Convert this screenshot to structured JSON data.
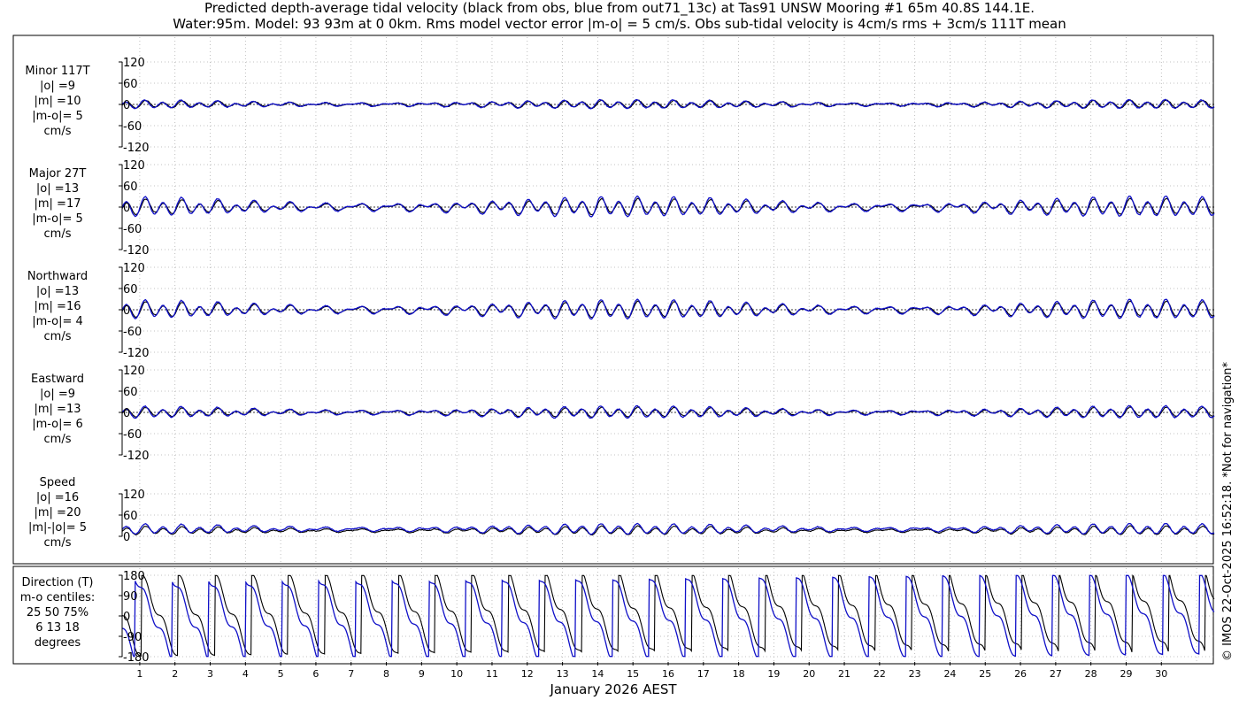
{
  "title_line1": "Predicted depth-average tidal velocity (black from obs, blue from out71_13c) at Tas91 UNSW Mooring #1 65m 40.8S 144.1E.",
  "title_line2": "Water:95m. Model: 93 93m at 0 0km. Rms model vector error |m-o| = 5 cm/s. Obs sub-tidal velocity is 4cm/s rms + 3cm/s 111T mean",
  "side_note": "© IMOS 22-Oct-2025 16:52:18. *Not for navigation*",
  "xlabel": "January 2026 AEST",
  "colors": {
    "obs": "#000000",
    "model": "#1010c8",
    "grid": "#b0b0b0"
  },
  "chart_data": [
    {
      "type": "line",
      "panel": "minor",
      "label_lines": [
        "Minor 117T",
        "|o| =9",
        "|m| =10",
        "|m-o|= 5",
        "cm/s"
      ],
      "yticks": [
        "120",
        "60",
        "0",
        "-60",
        "-120"
      ],
      "ylim": [
        -120,
        120
      ],
      "x_range_days": [
        0.5,
        31.5
      ],
      "grid": true,
      "series": [
        {
          "role": "obs",
          "amp": 9,
          "phase": 0.0,
          "offset": 0
        },
        {
          "role": "model",
          "amp": 10,
          "phase": 0.4,
          "offset": 0
        }
      ]
    },
    {
      "type": "line",
      "panel": "major",
      "label_lines": [
        "Major 27T",
        "|o| =13",
        "|m| =17",
        "|m-o|= 5",
        "cm/s"
      ],
      "yticks": [
        "120",
        "60",
        "0",
        "-60",
        "-120"
      ],
      "ylim": [
        -120,
        120
      ],
      "x_range_days": [
        0.5,
        31.5
      ],
      "grid": true,
      "series": [
        {
          "role": "obs",
          "amp": 18,
          "phase": 0.0,
          "offset": 0
        },
        {
          "role": "model",
          "amp": 23,
          "phase": 0.2,
          "offset": 0
        }
      ]
    },
    {
      "type": "line",
      "panel": "northward",
      "label_lines": [
        "Northward",
        "|o| =13",
        "|m| =16",
        "|m-o|= 4",
        "cm/s"
      ],
      "yticks": [
        "120",
        "60",
        "0",
        "-60",
        "-120"
      ],
      "ylim": [
        -120,
        120
      ],
      "x_range_days": [
        0.5,
        31.5
      ],
      "grid": true,
      "series": [
        {
          "role": "obs",
          "amp": 18,
          "phase": 0.0,
          "offset": 0
        },
        {
          "role": "model",
          "amp": 22,
          "phase": 0.2,
          "offset": 0
        }
      ]
    },
    {
      "type": "line",
      "panel": "eastward",
      "label_lines": [
        "Eastward",
        "|o| =9",
        "|m| =13",
        "|m-o|= 6",
        "cm/s"
      ],
      "yticks": [
        "120",
        "60",
        "0",
        "-60",
        "-120"
      ],
      "ylim": [
        -120,
        120
      ],
      "x_range_days": [
        0.5,
        31.5
      ],
      "grid": true,
      "series": [
        {
          "role": "obs",
          "amp": 11,
          "phase": 0.0,
          "offset": 0
        },
        {
          "role": "model",
          "amp": 14,
          "phase": 0.3,
          "offset": 0
        }
      ]
    },
    {
      "type": "line",
      "panel": "speed",
      "label_lines": [
        "Speed",
        "|o| =16",
        "|m| =20",
        "|m|-|o|= 5",
        "cm/s"
      ],
      "yticks": [
        "120",
        "60",
        "0"
      ],
      "ylim": [
        0,
        120
      ],
      "x_range_days": [
        0.5,
        31.5
      ],
      "grid": true,
      "series": [
        {
          "role": "obs",
          "amp": 10,
          "phase": 0.0,
          "offset": 16
        },
        {
          "role": "model",
          "amp": 12,
          "phase": 0.2,
          "offset": 20
        }
      ]
    },
    {
      "type": "line",
      "panel": "direction",
      "label_lines": [
        "Direction (T)",
        "m-o centiles:",
        "25  50  75%",
        "6  13  18",
        "degrees"
      ],
      "yticks": [
        "180",
        "90",
        "0",
        "-90",
        "-180"
      ],
      "ylim": [
        -180,
        180
      ],
      "x_range_days": [
        0.5,
        31.5
      ],
      "grid": true,
      "series": [
        {
          "role": "obs",
          "phase": 0.0,
          "offset": 0
        },
        {
          "role": "model",
          "phase": 0.15,
          "offset": 6
        }
      ]
    }
  ],
  "xticks": [
    "1",
    "2",
    "3",
    "4",
    "5",
    "6",
    "7",
    "8",
    "9",
    "10",
    "11",
    "12",
    "13",
    "14",
    "15",
    "16",
    "17",
    "18",
    "19",
    "20",
    "21",
    "22",
    "23",
    "24",
    "25",
    "26",
    "27",
    "28",
    "29",
    "30"
  ]
}
